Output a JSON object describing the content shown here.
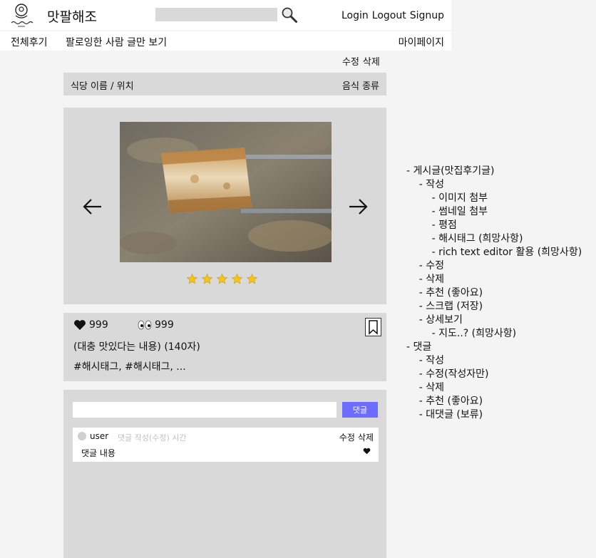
{
  "header": {
    "brand": "맛팔해조",
    "login": "Login",
    "logout": "Logout",
    "signup": "Signup"
  },
  "nav": {
    "all_reviews": "전체후기",
    "following_only": "팔로잉한 사람 글만 보기",
    "my_page": "마이페이지"
  },
  "post": {
    "edit": "수정",
    "delete": "삭제",
    "restaurant": "식당 이름 / 위치",
    "food_type": "음식 종류",
    "rating": 5,
    "likes": "999",
    "views": "999",
    "summary": "(대충 맛있다는 내용) (140자)",
    "hashtags": "#해시태그, #해시태그, ..."
  },
  "comments": {
    "submit_label": "댓글",
    "input_value": "",
    "items": [
      {
        "user": "user",
        "time": "댓글 작성(수정) 시간",
        "edit": "수정",
        "delete": "삭제",
        "body": "댓글 내용"
      }
    ]
  },
  "notes": [
    "- 게시글(맛집후기글)",
    "    - 작성",
    "        - 이미지 첨부",
    "        - 썸네일 첨부",
    "        - 평점",
    "        - 해시태그 (희망사항)",
    "        - rich text editor 활용 (희망사항)",
    "    - 수정",
    "    - 삭제",
    "    - 추천 (좋아요)",
    "    - 스크랩 (저장)",
    "    - 상세보기",
    "        - 지도..? (희망사항)",
    "- 댓글",
    "    - 작성",
    "    - 수정(작성자만)",
    "    - 삭제",
    "    - 추천 (좋아요)",
    "    - 대댓글 (보류)"
  ],
  "icons": {
    "logo": "follow-taste-logo",
    "search": "magnifier-icon",
    "prev": "arrow-left-icon",
    "next": "arrow-right-icon",
    "star": "star-icon",
    "like": "heart-icon",
    "views": "eyes-icon",
    "bookmark": "bookmark-icon"
  },
  "colors": {
    "panel": "#d9d9d9",
    "background": "#f4f4f4",
    "accent": "#6c6cff",
    "star": "#f5c518"
  }
}
